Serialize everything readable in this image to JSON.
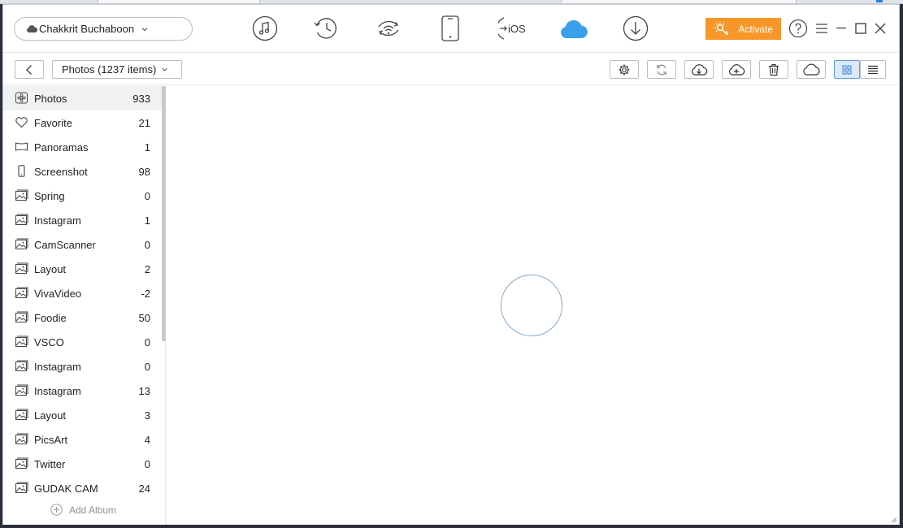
{
  "device": {
    "name": "Chakkrit Buchaboon",
    "icon": "cloud-icon"
  },
  "nav_icons": [
    {
      "name": "music-icon"
    },
    {
      "name": "history-icon"
    },
    {
      "name": "wifi-sync-icon"
    },
    {
      "name": "phone-icon"
    },
    {
      "name": "ios-transfer-icon",
      "label": "iOS"
    },
    {
      "name": "icloud-icon",
      "active": true,
      "color": "#3aa0ec"
    },
    {
      "name": "download-icon"
    }
  ],
  "activate": {
    "label": "Activate",
    "color": "#f7972a"
  },
  "subbar": {
    "album_label": "Photos (1237 items)"
  },
  "sidebar": {
    "albums": [
      {
        "label": "Photos",
        "count": "933",
        "icon": "photos-icon"
      },
      {
        "label": "Favorite",
        "count": "21",
        "icon": "heart-icon"
      },
      {
        "label": "Panoramas",
        "count": "1",
        "icon": "panorama-icon"
      },
      {
        "label": "Screenshot",
        "count": "98",
        "icon": "screenshot-icon"
      },
      {
        "label": "Spring",
        "count": "0",
        "icon": "album-icon"
      },
      {
        "label": "Instagram",
        "count": "1",
        "icon": "album-icon"
      },
      {
        "label": "CamScanner",
        "count": "0",
        "icon": "album-icon"
      },
      {
        "label": "Layout",
        "count": "2",
        "icon": "album-icon"
      },
      {
        "label": "VivaVideo",
        "count": "-2",
        "icon": "album-icon"
      },
      {
        "label": "Foodie",
        "count": "50",
        "icon": "album-icon"
      },
      {
        "label": "VSCO",
        "count": "0",
        "icon": "album-icon"
      },
      {
        "label": "Instagram",
        "count": "0",
        "icon": "album-icon"
      },
      {
        "label": "Instagram",
        "count": "13",
        "icon": "album-icon"
      },
      {
        "label": "Layout",
        "count": "3",
        "icon": "album-icon"
      },
      {
        "label": "PicsArt",
        "count": "4",
        "icon": "album-icon"
      },
      {
        "label": "Twitter",
        "count": "0",
        "icon": "album-icon"
      },
      {
        "label": "GUDAK CAM",
        "count": "24",
        "icon": "album-icon"
      }
    ],
    "add_album_label": "Add Album"
  }
}
